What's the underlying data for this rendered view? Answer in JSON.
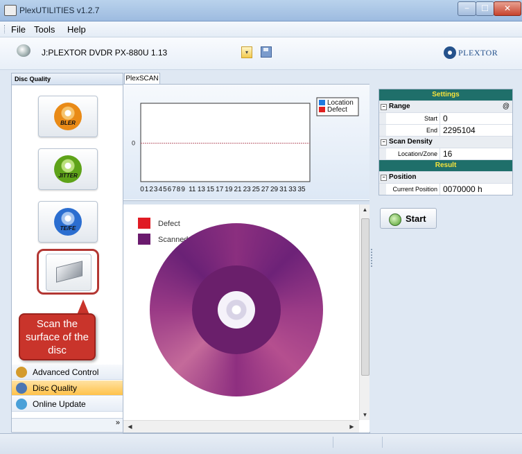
{
  "window": {
    "title": "PlexUTILITIES v1.2.7",
    "controls": {
      "minimize": "−",
      "maximize": "☐",
      "close": "✕"
    }
  },
  "menu": {
    "items": [
      {
        "label": "File"
      },
      {
        "label": "Tools"
      },
      {
        "label": "Help"
      }
    ]
  },
  "toolbar": {
    "drive_label": "J:PLEXTOR DVDR PX-880U 1.13",
    "dropdown_glyph": "▾",
    "logo_text": "PLEXTOR"
  },
  "left_panel": {
    "header": "Disc Quality",
    "buttons": [
      {
        "name": "bler",
        "label": "BLER"
      },
      {
        "name": "jitter",
        "label": "JITTER"
      },
      {
        "name": "tefe",
        "label": "TE/FE"
      }
    ],
    "nav": [
      {
        "label": "Advanced Control",
        "active": false
      },
      {
        "label": "Disc Quality",
        "active": true
      },
      {
        "label": "Online Update",
        "active": false
      }
    ],
    "footer_glyph": "»"
  },
  "callout": {
    "lines": [
      "Scan the",
      "surface of the",
      "disc"
    ]
  },
  "tab": {
    "label": "PlexSCAN"
  },
  "chart_data": {
    "type": "line",
    "title": "",
    "xlabel": "",
    "ylabel": "",
    "x_ticks": [
      "0",
      "1",
      "2",
      "3",
      "4",
      "5",
      "6",
      "7",
      "8",
      "9",
      "11",
      "13",
      "15",
      "17",
      "19",
      "21",
      "23",
      "25",
      "27",
      "29",
      "31",
      "33",
      "35"
    ],
    "y_ticks": [
      "0"
    ],
    "series": [
      {
        "name": "Location",
        "color": "#1f7ae0",
        "values": []
      },
      {
        "name": "Defect",
        "color": "#e02020",
        "values": []
      }
    ],
    "grid": false,
    "legend": "top-right"
  },
  "disc_legend": [
    {
      "label": "Defect",
      "color": "#e01b24"
    },
    {
      "label": "Scanned",
      "color": "#6b1a6e"
    }
  ],
  "settings": {
    "header": "Settings",
    "range": {
      "label": "Range",
      "at_symbol": "@",
      "start_key": "Start",
      "start_val": "0",
      "end_key": "End",
      "end_val": "2295104"
    },
    "density": {
      "label": "Scan Density",
      "key": "Location/Zone",
      "val": "16"
    },
    "result_header": "Result",
    "position": {
      "label": "Position",
      "key": "Current Position",
      "val": "0070000  h"
    },
    "collapse_glyph": "−"
  },
  "start_button": {
    "label": "Start"
  },
  "colors": {
    "accent": "#1f6f6a",
    "header_text": "#f6e33b",
    "callout": "#c9342b",
    "brand": "#25528c"
  }
}
